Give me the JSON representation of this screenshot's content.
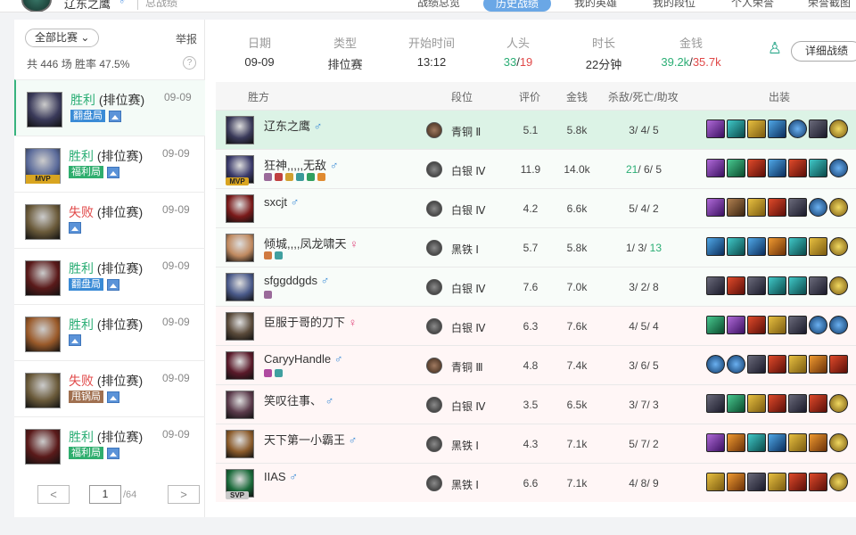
{
  "topbar": {
    "player_name": "辽东之鹰",
    "player_nick": "总战绩",
    "gender_icon": "♂",
    "tabs": [
      {
        "label": "战绩总览"
      },
      {
        "label": "历史战绩",
        "active": true
      },
      {
        "label": "我的英雄"
      },
      {
        "label": "我的段位"
      },
      {
        "label": "个人荣誉"
      },
      {
        "label": "荣誉截图"
      }
    ]
  },
  "sidebar": {
    "filter_label": "全部比赛 ⌄",
    "report_label": "举报",
    "stats_label": "共 446 场 胜率 47.5%",
    "help_icon": "?",
    "matches": [
      {
        "result": "胜利",
        "type": "(排位赛)",
        "date": "09-09",
        "tag": "翻盘局",
        "tag_color": "blue",
        "win": true,
        "hero_color": "#3a3a5a",
        "selected": true
      },
      {
        "result": "胜利",
        "type": "(排位赛)",
        "date": "09-09",
        "tag": "福利局",
        "tag_color": "green",
        "win": true,
        "hero_color": "#5a6a9a",
        "mvp": true
      },
      {
        "result": "失败",
        "type": "(排位赛)",
        "date": "09-09",
        "tag": "",
        "win": false,
        "hero_color": "#6a5a3a"
      },
      {
        "result": "胜利",
        "type": "(排位赛)",
        "date": "09-09",
        "tag": "翻盘局",
        "tag_color": "blue",
        "win": true,
        "hero_color": "#5a1a1a"
      },
      {
        "result": "胜利",
        "type": "(排位赛)",
        "date": "09-09",
        "tag": "",
        "win": true,
        "hero_color": "#9a5a2a"
      },
      {
        "result": "失败",
        "type": "(排位赛)",
        "date": "09-09",
        "tag": "甩锅局",
        "tag_color": "brown",
        "win": false,
        "hero_color": "#6a5a3a"
      },
      {
        "result": "胜利",
        "type": "(排位赛)",
        "date": "09-09",
        "tag": "福利局",
        "tag_color": "green",
        "win": true,
        "hero_color": "#5a1a1a"
      }
    ],
    "pager": {
      "prev": "<",
      "current": "1",
      "total": "/64",
      "next": ">"
    }
  },
  "summary": {
    "date": {
      "label": "日期",
      "value": "09-09"
    },
    "type": {
      "label": "类型",
      "value": "排位赛"
    },
    "start": {
      "label": "开始时间",
      "value": "13:12"
    },
    "kills": {
      "label": "人头",
      "value_a": "33",
      "sep": "/",
      "value_b": "19"
    },
    "duration": {
      "label": "时长",
      "value": "22分钟"
    },
    "gold": {
      "label": "金钱",
      "value_a": "39.2k",
      "sep": "/",
      "value_b": "35.7k"
    },
    "mvp_icon": "trophy-icon",
    "detail_button": "详细战绩"
  },
  "table": {
    "headers": {
      "team": "胜方",
      "rank": "段位",
      "score": "评价",
      "gold": "金钱",
      "kda": "杀敌/死亡/助攻",
      "items": "出装"
    },
    "rows": [
      {
        "name": "辽东之鹰",
        "gender": "♂",
        "g": "m",
        "rank": "青铜 Ⅱ",
        "rank_type": "br",
        "score": "5.1",
        "gold": "5.8k",
        "k": "3",
        "d": "4",
        "a": "5",
        "style": "self",
        "hero": "#3a3a5a",
        "items": [
          "purple",
          "teal",
          "gold1",
          "blue",
          "bward",
          "dark",
          "ward"
        ]
      },
      {
        "name": "狂神,,,,,无敌",
        "gender": "♂",
        "g": "m",
        "rank": "白银 Ⅳ",
        "rank_type": "s",
        "score": "11.9",
        "gold": "14.0k",
        "k": "21",
        "d": "6",
        "a": "5",
        "style": "t1",
        "hero": "#3a3a6a",
        "mvp": "MVP",
        "score_g": true,
        "badges": [
          "#9a6a9a",
          "#c04040",
          "#d0a030",
          "#3a9a9a",
          "#30a060",
          "#e08a30"
        ],
        "items": [
          "purple",
          "green",
          "red",
          "blue",
          "red",
          "teal",
          "bward"
        ]
      },
      {
        "name": "sxcjt",
        "gender": "♂",
        "g": "m",
        "rank": "白银 Ⅳ",
        "rank_type": "s",
        "score": "4.2",
        "gold": "6.6k",
        "k": "5",
        "d": "4",
        "a": "2",
        "style": "t1",
        "hero": "#7a1a1a",
        "items": [
          "purple",
          "brown",
          "gold1",
          "red",
          "dark",
          "bward",
          "ward"
        ]
      },
      {
        "name": "倾城,,,,凤龙啸天",
        "gender": "♀",
        "g": "f",
        "rank": "黑铁 Ⅰ",
        "rank_type": "s",
        "score": "5.7",
        "gold": "5.8k",
        "k": "1",
        "d": "3",
        "a": "13",
        "style": "t1",
        "hero": "#c08a60",
        "badges": [
          "#d07a40",
          "#40a0a0"
        ],
        "items": [
          "blue",
          "teal",
          "blue",
          "orange",
          "teal",
          "gold1",
          "ward"
        ]
      },
      {
        "name": "sfggddgds",
        "gender": "♂",
        "g": "m",
        "rank": "白银 Ⅳ",
        "rank_type": "s",
        "score": "7.6",
        "gold": "7.0k",
        "k": "3",
        "d": "2",
        "a": "8",
        "style": "t1",
        "hero": "#4a5a8a",
        "badges": [
          "#9a6a9a"
        ],
        "items": [
          "dark",
          "red",
          "dark",
          "teal",
          "teal",
          "dark",
          "ward"
        ]
      },
      {
        "name": "臣服于哥的刀下",
        "gender": "♀",
        "g": "f",
        "rank": "白银 Ⅳ",
        "rank_type": "s",
        "score": "6.3",
        "gold": "7.6k",
        "k": "4",
        "d": "5",
        "a": "4",
        "style": "t2",
        "hero": "#5a4a3a",
        "items": [
          "green",
          "purple",
          "red",
          "gold1",
          "dark",
          "bward",
          "bward"
        ]
      },
      {
        "name": "CaryyHandle",
        "gender": "♂",
        "g": "m",
        "rank": "青铜 Ⅲ",
        "rank_type": "br",
        "score": "4.8",
        "gold": "7.4k",
        "k": "3",
        "d": "6",
        "a": "5",
        "style": "t2",
        "hero": "#5a1a2a",
        "badges": [
          "#b04aa0",
          "#40a0a0"
        ],
        "items": [
          "bward",
          "bward",
          "dark",
          "red",
          "gold1",
          "orange",
          "red"
        ]
      },
      {
        "name": "笑叹往事、",
        "gender": "♂",
        "g": "m",
        "rank": "白银 Ⅳ",
        "rank_type": "s",
        "score": "3.5",
        "gold": "6.5k",
        "k": "3",
        "d": "7",
        "a": "3",
        "style": "t2",
        "hero": "#5a3a4a",
        "items": [
          "dark",
          "green",
          "gold1",
          "red",
          "dark",
          "red",
          "ward"
        ]
      },
      {
        "name": "天下第一小霸王",
        "gender": "♂",
        "g": "m",
        "rank": "黑铁 Ⅰ",
        "rank_type": "s",
        "score": "4.3",
        "gold": "7.1k",
        "k": "5",
        "d": "7",
        "a": "2",
        "style": "t2",
        "hero": "#8a5a2a",
        "items": [
          "purple",
          "orange",
          "teal",
          "blue",
          "gold1",
          "orange",
          "ward"
        ]
      },
      {
        "name": "IIAS",
        "gender": "♂",
        "g": "m",
        "rank": "黑铁 Ⅰ",
        "rank_type": "s",
        "score": "6.6",
        "gold": "7.1k",
        "k": "4",
        "d": "8",
        "a": "9",
        "style": "t2",
        "hero": "#1a6a3a",
        "mvp": "SVP",
        "items": [
          "gold1",
          "orange",
          "dark",
          "gold1",
          "red",
          "red",
          "ward"
        ]
      }
    ]
  }
}
